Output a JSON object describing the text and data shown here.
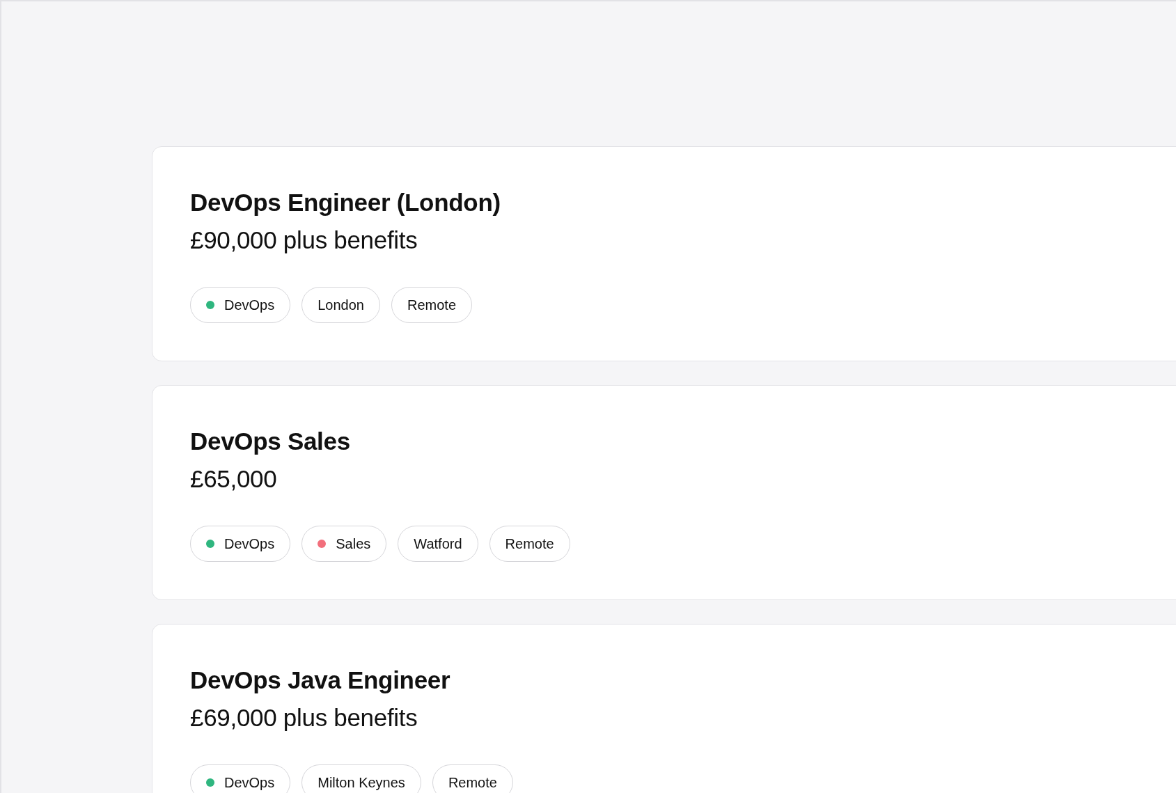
{
  "jobs": [
    {
      "title": "DevOps Engineer (London)",
      "salary": "£90,000 plus benefits",
      "tags": [
        {
          "label": "DevOps",
          "color": "#2fb67f"
        },
        {
          "label": "London"
        },
        {
          "label": "Remote"
        }
      ]
    },
    {
      "title": "DevOps Sales",
      "salary": "£65,000",
      "tags": [
        {
          "label": "DevOps",
          "color": "#2fb67f"
        },
        {
          "label": "Sales",
          "color": "#f26f7c"
        },
        {
          "label": "Watford"
        },
        {
          "label": "Remote"
        }
      ]
    },
    {
      "title": "DevOps Java Engineer",
      "salary": "£69,000 plus benefits",
      "tags": [
        {
          "label": "DevOps",
          "color": "#2fb67f"
        },
        {
          "label": "Milton Keynes"
        },
        {
          "label": "Remote"
        }
      ]
    }
  ]
}
